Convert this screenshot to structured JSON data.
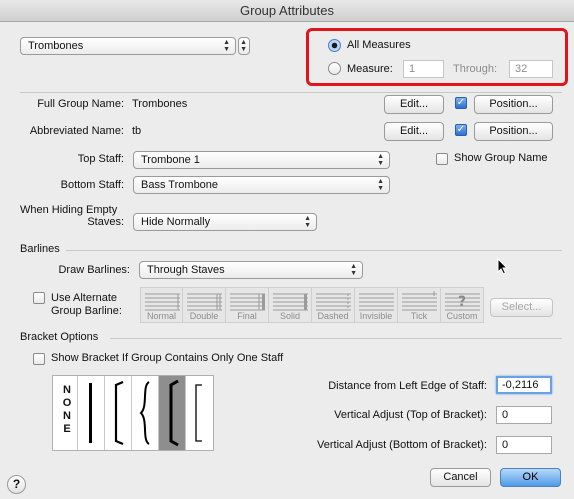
{
  "window": {
    "title": "Group Attributes"
  },
  "group_select": {
    "value": "Trombones"
  },
  "measures": {
    "all_label": "All Measures",
    "measure_label": "Measure:",
    "measure_from": "1",
    "through_label": "Through:",
    "measure_to": "32",
    "selected": "all"
  },
  "full_name": {
    "label": "Full Group Name:",
    "value": "Trombones",
    "edit": "Edit...",
    "position": "Position...",
    "checked": true
  },
  "abbr_name": {
    "label": "Abbreviated Name:",
    "value": "tb",
    "edit": "Edit...",
    "position": "Position...",
    "checked": true
  },
  "top_staff": {
    "label": "Top Staff:",
    "value": "Trombone 1"
  },
  "show_group_name": {
    "label": "Show Group Name",
    "checked": false
  },
  "bottom_staff": {
    "label": "Bottom Staff:",
    "value": "Bass Trombone"
  },
  "hiding": {
    "label_line1": "When Hiding Empty",
    "label_line2": "Staves:",
    "value": "Hide Normally"
  },
  "barlines": {
    "section": "Barlines",
    "draw_label": "Draw Barlines:",
    "draw_value": "Through Staves",
    "alt_line1": "Use Alternate",
    "alt_line2": "Group Barline:",
    "alt_checked": false,
    "styles": [
      "Normal",
      "Double",
      "Final",
      "Solid",
      "Dashed",
      "Invisible",
      "Tick",
      "Custom"
    ],
    "select_button": "Select..."
  },
  "brackets": {
    "section": "Bracket Options",
    "show_single": "Show Bracket If Group Contains Only One Staff",
    "show_single_checked": false,
    "none_text": "NONE",
    "distance_label": "Distance from Left Edge of Staff:",
    "distance_value": "-0,2116",
    "vtop_label": "Vertical Adjust (Top of Bracket):",
    "vtop_value": "0",
    "vbottom_label": "Vertical Adjust (Bottom of Bracket):",
    "vbottom_value": "0"
  },
  "footer": {
    "cancel": "Cancel",
    "ok": "OK",
    "help": "?"
  },
  "colors": {
    "highlight": "#e0141b",
    "accent": "#4f9ae6"
  }
}
